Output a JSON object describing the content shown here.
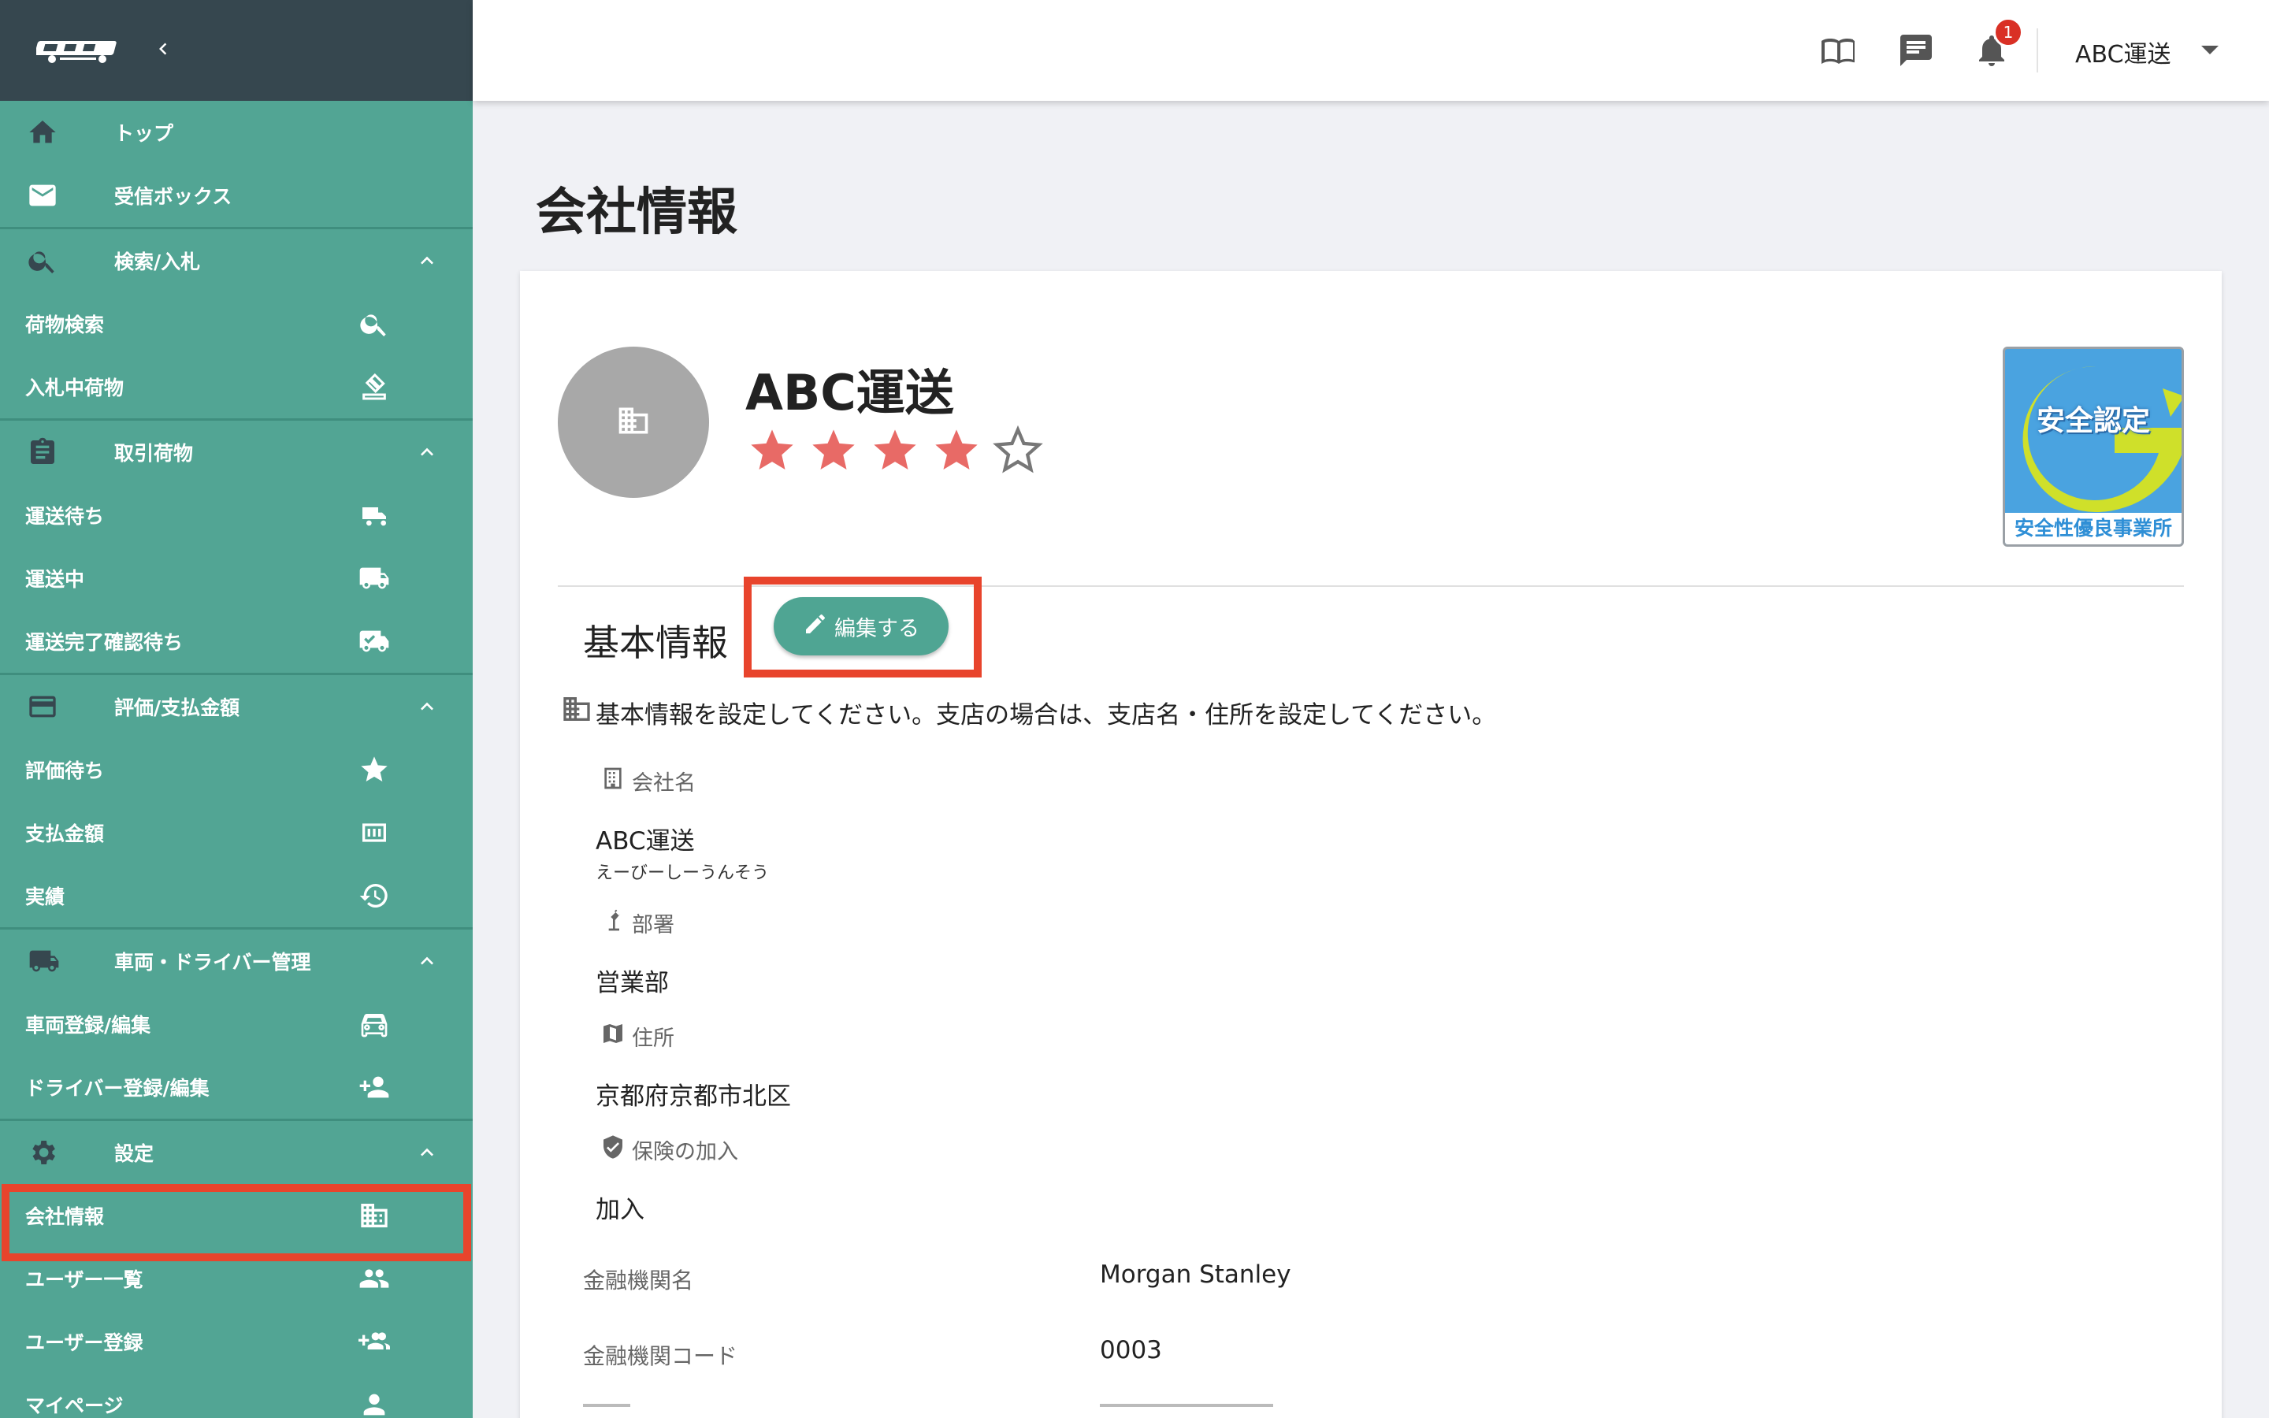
{
  "brand": {
    "primary": "#52a594",
    "header_dark": "#36474f",
    "highlight": "#e8442c"
  },
  "sidebar": {
    "items": [
      {
        "label": "トップ",
        "icon": "home-icon"
      },
      {
        "label": "受信ボックス",
        "icon": "mail-icon"
      },
      {
        "label": "検索/入札",
        "icon": "search-icon"
      },
      {
        "label": "荷物検索",
        "icon": "search-icon"
      },
      {
        "label": "入札中荷物",
        "icon": "gavel-icon"
      },
      {
        "label": "取引荷物",
        "icon": "clipboard-icon"
      },
      {
        "label": "運送待ち",
        "icon": "truck-icon"
      },
      {
        "label": "運送中",
        "icon": "truck-moving-icon"
      },
      {
        "label": "運送完了確認待ち",
        "icon": "truck-check-icon"
      },
      {
        "label": "評価/支払金額",
        "icon": "card-icon"
      },
      {
        "label": "評価待ち",
        "icon": "star-icon"
      },
      {
        "label": "支払金額",
        "icon": "money-icon"
      },
      {
        "label": "実績",
        "icon": "history-icon"
      },
      {
        "label": "車両・ドライバー管理",
        "icon": "truck-icon"
      },
      {
        "label": "車両登録/編集",
        "icon": "car-icon"
      },
      {
        "label": "ドライバー登録/編集",
        "icon": "person-add-icon"
      },
      {
        "label": "設定",
        "icon": "gear-icon"
      },
      {
        "label": "会社情報",
        "icon": "building-icon"
      },
      {
        "label": "ユーザー一覧",
        "icon": "people-icon"
      },
      {
        "label": "ユーザー登録",
        "icon": "group-add-icon"
      },
      {
        "label": "マイページ",
        "icon": "person-icon"
      }
    ]
  },
  "topbar": {
    "notification_count": "1",
    "user": "ABC運送"
  },
  "page": {
    "title": "会社情報"
  },
  "company": {
    "name": "ABC運送",
    "rating": 4,
    "rating_max": 5,
    "cert_top": "安全認定",
    "cert_bottom": "安全性優良事業所"
  },
  "basic_info": {
    "title": "基本情報",
    "edit_label": "編集する",
    "notice": "基本情報を設定してください。支店の場合は、支店名・住所を設定してください。",
    "company_name_label": "会社名",
    "company_name": "ABC運送",
    "company_kana": "えーびーしーうんそう",
    "department_label": "部署",
    "department": "営業部",
    "address_label": "住所",
    "address": "京都府京都市北区",
    "insurance_label": "保険の加入",
    "insurance": "加入"
  },
  "bank": {
    "name_label": "金融機関名",
    "name": "Morgan Stanley",
    "code_label": "金融機関コード",
    "code": "0003"
  }
}
